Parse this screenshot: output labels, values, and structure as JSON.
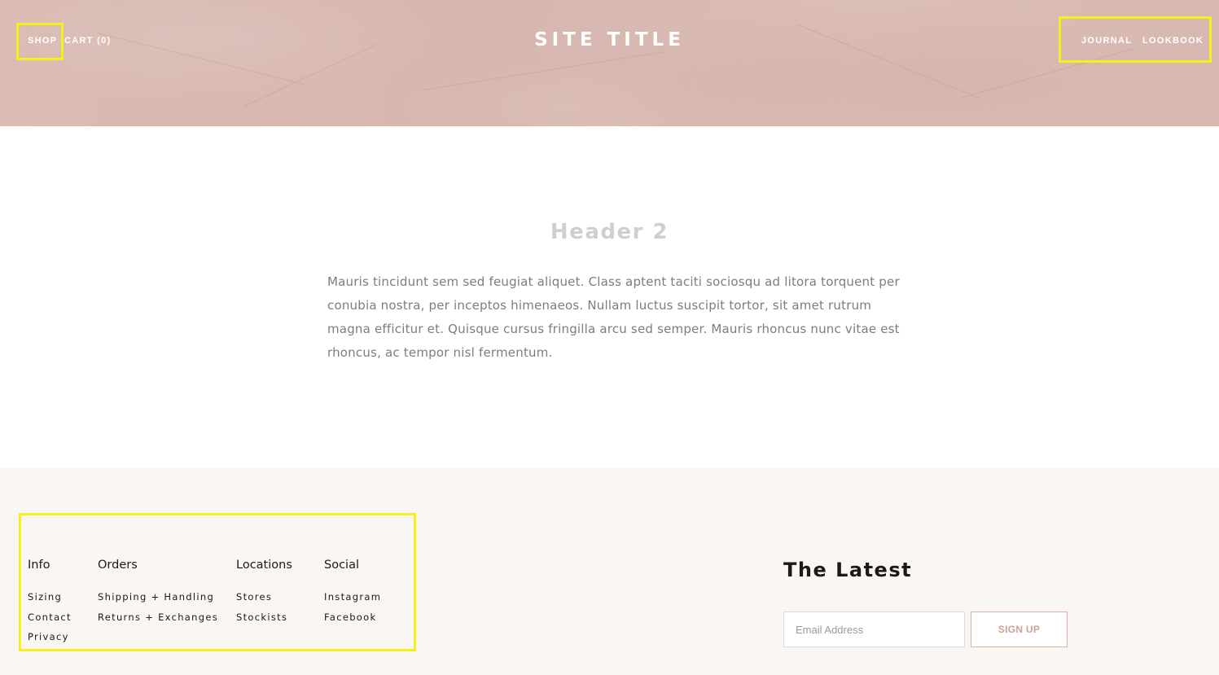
{
  "header": {
    "nav_left": [
      "SHOP",
      "CART (0)"
    ],
    "site_title": "SITE TITLE",
    "nav_right": [
      "JOURNAL",
      "LOOKBOOK"
    ]
  },
  "main": {
    "heading": "Header 2",
    "body": "Mauris tincidunt sem sed feugiat aliquet. Class aptent taciti sociosqu ad litora torquent per conubia nostra, per inceptos himenaeos. Nullam luctus suscipit tortor, sit amet rutrum magna efficitur et. Quisque cursus fringilla arcu sed semper. Mauris rhoncus nunc vitae est rhoncus, ac tempor nisl fermentum."
  },
  "footer": {
    "columns": [
      {
        "title": "Info",
        "links": [
          "Sizing",
          "Contact",
          "Privacy"
        ]
      },
      {
        "title": "Orders",
        "links": [
          "Shipping + Handling",
          "Returns + Exchanges"
        ]
      },
      {
        "title": "Locations",
        "links": [
          "Stores",
          "Stockists"
        ]
      },
      {
        "title": "Social",
        "links": [
          "Instagram",
          "Facebook"
        ]
      }
    ],
    "newsletter": {
      "title": "The Latest",
      "email_placeholder": "Email Address",
      "signup_label": "SIGN UP"
    }
  },
  "colors": {
    "header_bg": "#d9bbb3",
    "footer_bg": "#f9f6f3",
    "highlight": "#f3f01c",
    "button_accent": "#c9a398"
  }
}
